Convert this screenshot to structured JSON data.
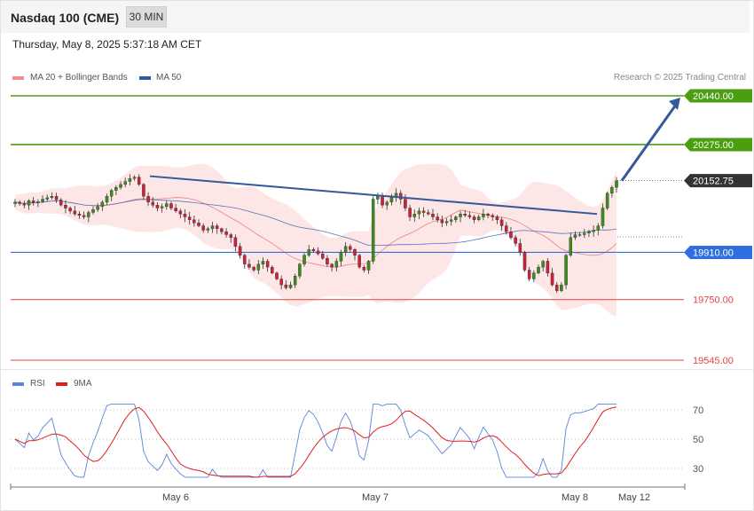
{
  "header": {
    "title": "Nasdaq 100 (CME)",
    "timeframe": "30 MIN"
  },
  "timestamp": "Thursday, May 8, 2025 5:37:18 AM CET",
  "legend": {
    "main": [
      {
        "label": "MA 20 + Bollinger Bands",
        "color": "#f28b8b"
      },
      {
        "label": "MA 50",
        "color": "#2f5d9a"
      }
    ],
    "rsi": [
      {
        "label": "RSI",
        "color": "#5b84d8"
      },
      {
        "label": "9MA",
        "color": "#e01e1e"
      }
    ]
  },
  "credit": "Research © 2025 Trading Central",
  "chart_data": {
    "type": "candlestick",
    "price_axis": {
      "min": 19545,
      "max": 20440
    },
    "levels": [
      {
        "label": "20440.00",
        "value": 20440,
        "kind": "resistance",
        "color": "#4a9e10"
      },
      {
        "label": "20275.00",
        "value": 20275,
        "kind": "resistance",
        "color": "#4a9e10"
      },
      {
        "label": "20152.75",
        "value": 20152.75,
        "kind": "last-price",
        "color": "#333333"
      },
      {
        "label": "19910.00",
        "value": 19910,
        "kind": "pivot",
        "color": "#2f6fe0"
      },
      {
        "label": "19750.00",
        "value": 19750,
        "kind": "support",
        "color": "#e24545"
      },
      {
        "label": "19545.00",
        "value": 19545,
        "kind": "support",
        "color": "#e24545"
      }
    ],
    "x_labels": [
      "May 6",
      "May 7",
      "May 8",
      "May 12"
    ],
    "rsi": {
      "levels": [
        "70",
        "50",
        "30"
      ],
      "series": [
        "RSI",
        "9MA"
      ]
    },
    "closes": [
      20080,
      20075,
      20070,
      20085,
      20078,
      20082,
      20090,
      20095,
      20100,
      20088,
      20070,
      20060,
      20050,
      20040,
      20035,
      20030,
      20045,
      20055,
      20065,
      20080,
      20100,
      20120,
      20130,
      20140,
      20150,
      20160,
      20165,
      20140,
      20100,
      20080,
      20070,
      20060,
      20065,
      20075,
      20060,
      20050,
      20040,
      20030,
      20020,
      20010,
      20000,
      19985,
      19990,
      20000,
      19990,
      19980,
      19970,
      19960,
      19930,
      19900,
      19870,
      19860,
      19850,
      19870,
      19880,
      19860,
      19840,
      19820,
      19800,
      19790,
      19800,
      19830,
      19870,
      19900,
      19920,
      19915,
      19905,
      19890,
      19870,
      19860,
      19880,
      19910,
      19930,
      19920,
      19900,
      19860,
      19850,
      19880,
      20090,
      20100,
      20070,
      20080,
      20095,
      20110,
      20090,
      20060,
      20030,
      20040,
      20050,
      20045,
      20040,
      20030,
      20020,
      20010,
      20015,
      20020,
      20030,
      20040,
      20035,
      20030,
      20020,
      20030,
      20040,
      20035,
      20030,
      20020,
      20000,
      19980,
      19960,
      19940,
      19910,
      19850,
      19820,
      19840,
      19860,
      19880,
      19840,
      19800,
      19780,
      19800,
      19900,
      19960,
      19970,
      19970,
      19975,
      19980,
      19985,
      20000,
      20060,
      20110,
      20130,
      20152.75
    ],
    "trendline": {
      "start_value": 20168,
      "end_value": 20040
    },
    "projection": {
      "start_value": 20152.75,
      "end_value": 20440
    }
  }
}
